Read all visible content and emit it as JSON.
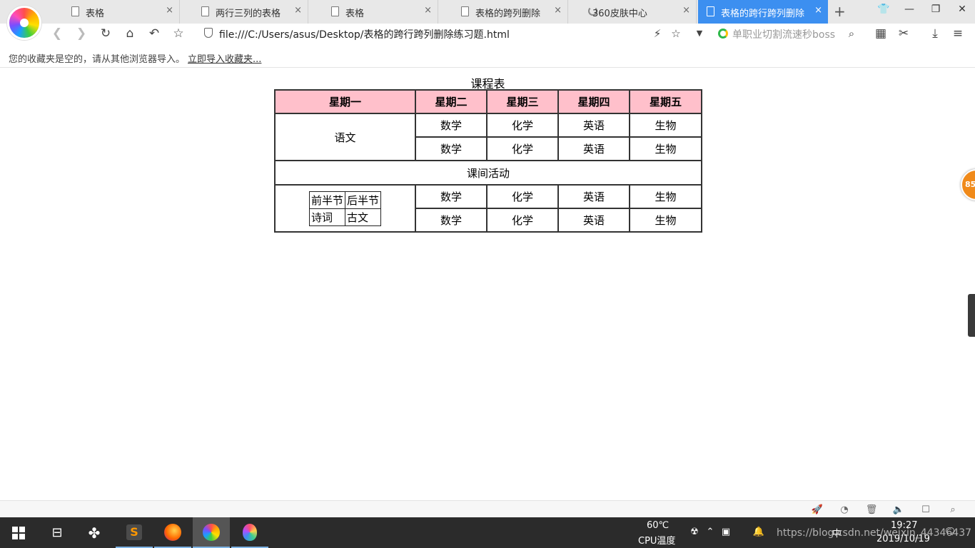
{
  "browser": {
    "tabs": [
      {
        "label": "表格",
        "icon": "document-icon",
        "active": false
      },
      {
        "label": "两行三列的表格",
        "icon": "document-icon",
        "active": false
      },
      {
        "label": "表格",
        "icon": "document-icon",
        "active": false
      },
      {
        "label": "表格的跨列删除",
        "icon": "document-icon",
        "active": false
      },
      {
        "label": "360皮肤中心",
        "icon": "loading-icon",
        "active": false
      },
      {
        "label": "表格的跨行跨列删除",
        "icon": "document-icon",
        "active": true
      }
    ],
    "close_glyph": "×",
    "new_tab_glyph": "+",
    "window_controls": {
      "minimize": "—",
      "restore": "❐",
      "close": "✕",
      "skin": "👕"
    },
    "address": "file:///C:/Users/asus/Desktop/表格的跨行跨列删除练习题.html",
    "search_placeholder": "单职业切割流速秒boss",
    "bookmark_message": "您的收藏夹是空的，请从其他浏览器导入。",
    "bookmark_import": "立即导入收藏夹...",
    "accent": "#3c8ff0"
  },
  "page": {
    "caption": "课程表",
    "headers": [
      "星期一",
      "星期二",
      "星期三",
      "星期四",
      "星期五"
    ],
    "header_bg": "#ffc0cb",
    "block1": {
      "merged": "语文",
      "rows": [
        [
          "数学",
          "化学",
          "英语",
          "生物"
        ],
        [
          "数学",
          "化学",
          "英语",
          "生物"
        ]
      ]
    },
    "activity": "课间活动",
    "block2": {
      "inner": [
        [
          "前半节",
          "后半节"
        ],
        [
          "诗词",
          "古文"
        ]
      ],
      "rows": [
        [
          "数学",
          "化学",
          "英语",
          "生物"
        ],
        [
          "数学",
          "化学",
          "英语",
          "生物"
        ]
      ]
    },
    "float_badge": "85"
  },
  "taskbar": {
    "temperature": "60℃",
    "temperature_label": "CPU温度",
    "time": "19:27",
    "date": "2019/10/19",
    "ime": "中",
    "watermark": "https://blog.csdn.net/weixin_44346437"
  }
}
